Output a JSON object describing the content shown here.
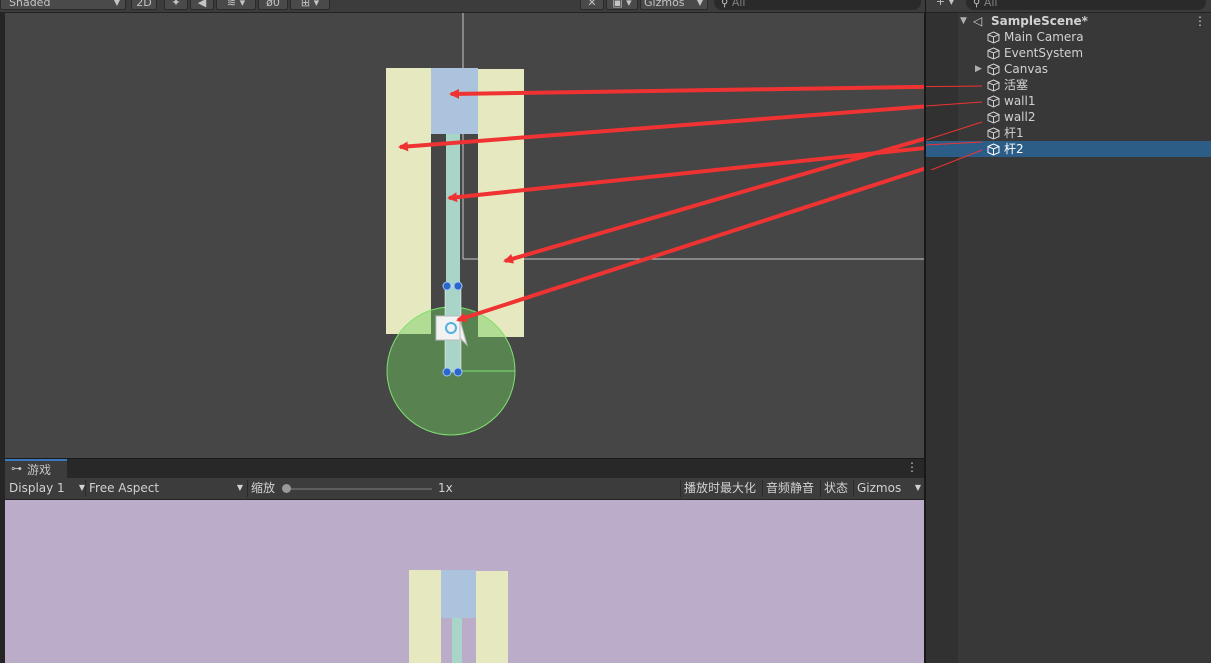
{
  "scene_toolbar": {
    "shading_mode": "Shaded",
    "mode_2d": "2D",
    "hidden_count": "0",
    "gizmos_label": "Gizmos",
    "search_placeholder": "All"
  },
  "hierarchy": {
    "search_placeholder": "All",
    "scene_name": "SampleScene*",
    "items": [
      {
        "label": "Main Camera"
      },
      {
        "label": "EventSystem"
      },
      {
        "label": "Canvas"
      },
      {
        "label": "活塞"
      },
      {
        "label": "wall1"
      },
      {
        "label": "wall2"
      },
      {
        "label": "杆1"
      },
      {
        "label": "杆2"
      }
    ],
    "selected_item": "杆2"
  },
  "game": {
    "tab_label": "游戏",
    "display": "Display 1",
    "aspect": "Free Aspect",
    "scale_label": "缩放",
    "scale_value": "1x",
    "maximize_on_play": "播放时最大化",
    "mute_audio": "音频静音",
    "stats": "状态",
    "gizmos": "Gizmos"
  },
  "colors": {
    "wall": "#e6e8c0",
    "piston": "#abc3dc",
    "rod": "#a9d4c8",
    "arrow": "#ef3333",
    "selection": "#2c5d87",
    "game_bg": "#bbadc9",
    "scene_bg": "#464646"
  }
}
